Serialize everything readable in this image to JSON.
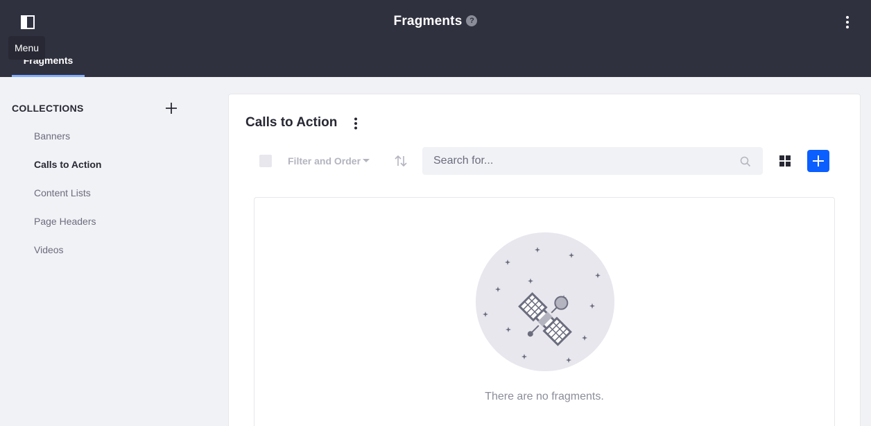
{
  "header": {
    "title": "Fragments",
    "help_label": "?",
    "tooltip": "Menu"
  },
  "nav": {
    "tabs": [
      {
        "label": "Fragments",
        "active": true
      }
    ]
  },
  "sidebar": {
    "title": "COLLECTIONS",
    "items": [
      {
        "label": "Banners",
        "active": false
      },
      {
        "label": "Calls to Action",
        "active": true
      },
      {
        "label": "Content Lists",
        "active": false
      },
      {
        "label": "Page Headers",
        "active": false
      },
      {
        "label": "Videos",
        "active": false
      }
    ]
  },
  "main": {
    "title": "Calls to Action",
    "filter_label": "Filter and Order",
    "search": {
      "placeholder": "Search for...",
      "value": ""
    },
    "empty_message": "There are no fragments."
  },
  "colors": {
    "topbar": "#30313f",
    "accent": "#0b5fff",
    "tab_indicator": "#80acff",
    "background": "#f1f2f5"
  },
  "icons": {
    "menu_toggle": "sidebar-toggle-icon",
    "help": "question-circle-icon",
    "options": "ellipsis-v-icon",
    "add_collection": "plus-icon",
    "sort": "order-arrow-icon",
    "search": "search-icon",
    "view": "cards-icon",
    "add_fragment": "plus-icon",
    "empty_state": "satellite-illustration"
  }
}
